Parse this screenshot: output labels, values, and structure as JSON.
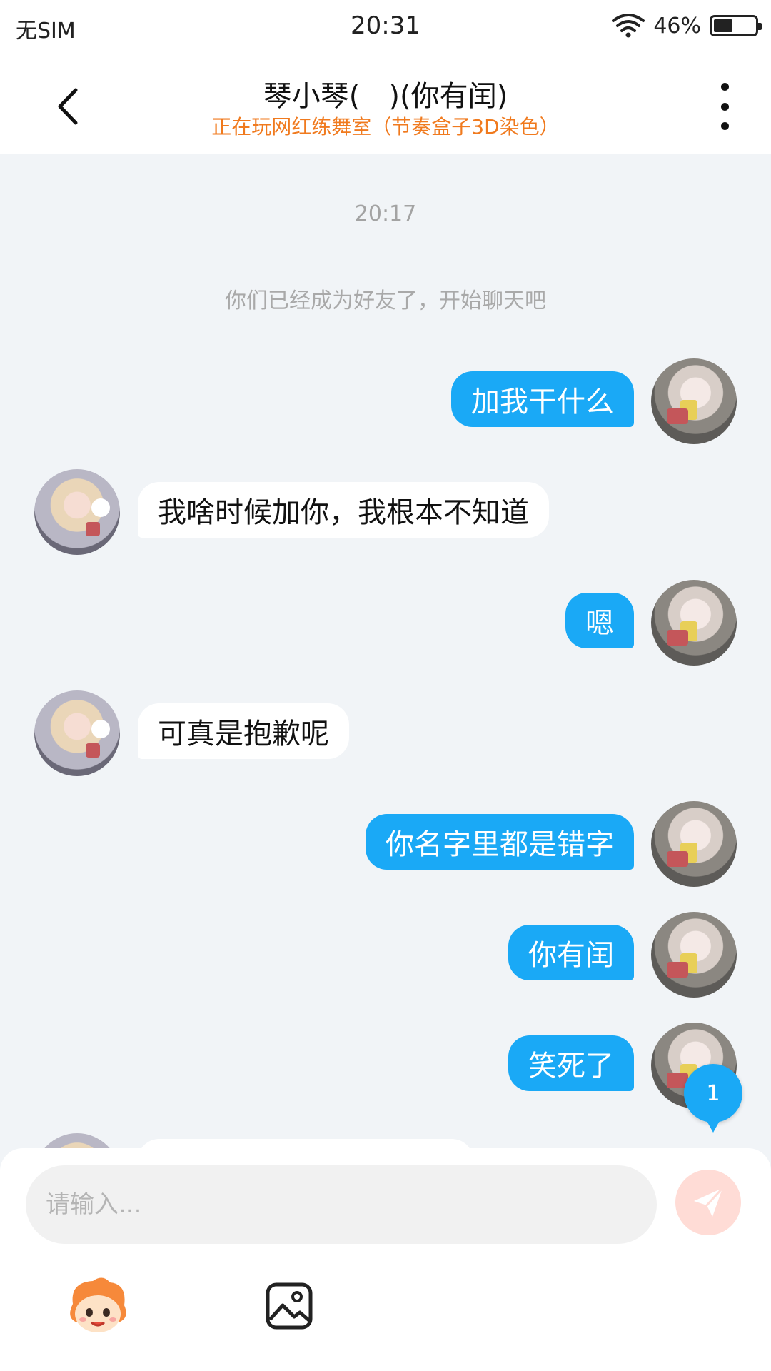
{
  "status_bar": {
    "carrier": "无SIM",
    "time": "20:31",
    "battery_percent_text": "46%",
    "battery_level": 0.46
  },
  "header": {
    "title": "琴小琴(　)(你有闰)",
    "subtitle": "正在玩网红练舞室（节奏盒子3D染色）",
    "back_icon": "chevron-left-icon",
    "more_icon": "more-vertical-icon"
  },
  "chat": {
    "timestamp": "20:17",
    "system_message": "你们已经成为好友了，开始聊天吧",
    "messages": [
      {
        "from": "me",
        "text": "加我干什么"
      },
      {
        "from": "other",
        "text": "我啥时候加你，我根本不知道"
      },
      {
        "from": "me",
        "text": "嗯"
      },
      {
        "from": "other",
        "text": "可真是抱歉呢"
      },
      {
        "from": "me",
        "text": "你名字里都是错字"
      },
      {
        "from": "me",
        "text": "你有闰"
      },
      {
        "from": "me",
        "text": "笑死了"
      }
    ],
    "unread_badge": "1"
  },
  "input_panel": {
    "placeholder": "请输入...",
    "send_icon": "paper-plane-icon",
    "emoji_icon": "mascot-face-icon",
    "image_icon": "image-icon"
  },
  "colors": {
    "accent": "#1aa9f6",
    "subtitle": "#f07a1e",
    "background": "#f1f4f7",
    "send_disabled": "#ffdcd6"
  }
}
